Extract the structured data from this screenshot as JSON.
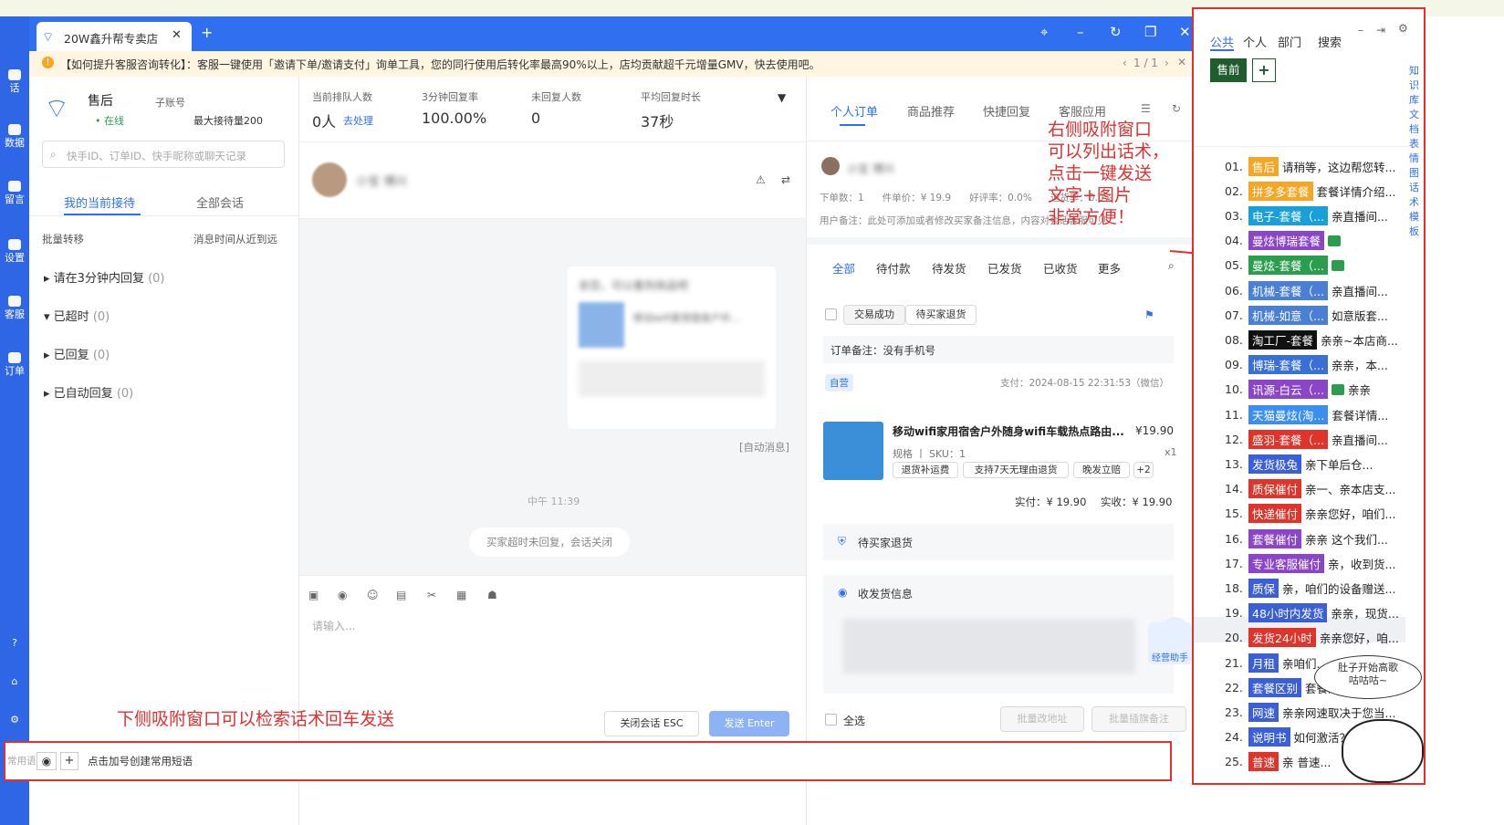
{
  "window": {
    "tab_title": "20W鑫升帮专卖店",
    "new_tab": "+",
    "close_tab": "✕"
  },
  "notice": {
    "text": "【如何提升客服咨询转化】：客服一键使用「邀请下单/邀请支付」询单工具，您的同行使用后转化率最高90%以上，店均贡献超千元增量GMV，快去使用吧。",
    "pager": "1 / 1"
  },
  "left_rail": {
    "items": [
      "话",
      "数据",
      "留言",
      "设置",
      "客服",
      "订单"
    ]
  },
  "agent": {
    "name": "售后",
    "role": "子账号",
    "status": "在线",
    "max_load": "最大接待量200",
    "search_placeholder": "快手ID、订单ID、快手昵称或聊天记录"
  },
  "left_tabs": {
    "mine": "我的当前接待",
    "all": "全部会话"
  },
  "batch": {
    "label": "批量转移",
    "sort": "消息时间从近到远"
  },
  "groups": [
    {
      "label": "请在3分钟内回复",
      "count": "(0)"
    },
    {
      "label": "已超时",
      "count": "(0)"
    },
    {
      "label": "已回复",
      "count": "(0)"
    },
    {
      "label": "已自动回复",
      "count": "(0)"
    }
  ],
  "stats": [
    {
      "label": "当前排队人数",
      "value": "0人",
      "extra": "去处理"
    },
    {
      "label": "3分钟回复率",
      "value": "100.00%"
    },
    {
      "label": "未回复人数",
      "value": "0"
    },
    {
      "label": "平均回复时长",
      "value": "37秒"
    }
  ],
  "chat": {
    "contact": "小宝 博兴",
    "card_title": "亲您，可以看到商品吧",
    "card_goods": "移动wifi家用宿舍户外...",
    "auto_msg": "[自动消息]",
    "time": "中午 11:39",
    "system": "买家超时未回复，会话关闭",
    "input_placeholder": "请输入...",
    "close_btn": "关闭会话 ESC",
    "send_btn": "发送 Enter"
  },
  "order": {
    "tabs": [
      "个人订单",
      "商品推荐",
      "快捷回复",
      "客服应用"
    ],
    "buyer": "小宝 博兴",
    "buyer_stats": "下单数：1      件单价：¥ 19.9      好评率：0.0%      退货率：0.0%",
    "remark": "用户备注：此处可添加或者修改买家备注信息，内容对会话客服可见",
    "subtabs": [
      "全部",
      "待付款",
      "待发货",
      "已发货",
      "已收货",
      "更多"
    ],
    "status1": "交易成功",
    "status2": "待买家退货",
    "order_note": "订单备注：没有手机号",
    "self_tag": "自营",
    "pay_time": "支付：2024-08-15 22:31:53（微信）",
    "goods_title": "移动wifi家用宿舍户外随身wifi车载热点路由...",
    "goods_price": "¥19.90",
    "goods_sku": "规格 丨 SKU：1",
    "goods_qty": "x1",
    "goods_tags": [
      "退货补运费",
      "支持7天无理由退货",
      "晚发立赔",
      "+2"
    ],
    "paid": "实付：¥ 19.90",
    "received": "实收：¥ 19.90",
    "returning": "待买家退货",
    "shipping": "收发货信息",
    "select_all": "全选",
    "btn_addr": "批量改地址",
    "btn_flag": "批量插旗备注",
    "assistant": "经营助手"
  },
  "annotations": {
    "right": "右侧吸附窗口\n可以列出话术，\n点击一键发送\n文字+图片\n非常方便！",
    "bottom": "下侧吸附窗口可以检索话术回车发送",
    "bubble": "肚子开始高歌\n咕咕咕~"
  },
  "right_panel": {
    "tabs": [
      "公共",
      "个人",
      "部门",
      "搜索"
    ],
    "btn_after": "售前",
    "btn_add": "+",
    "side_labels": "知识库 文档 表情图 话术模板",
    "rows": [
      {
        "num": "01.",
        "tag": "售后",
        "color": "#f5a623",
        "text": "请稍等，这边帮您转..."
      },
      {
        "num": "02.",
        "tag": "拼多多套餐",
        "color": "#f5a623",
        "text": "套餐详情介绍..."
      },
      {
        "num": "03.",
        "tag": "电子-套餐（...",
        "color": "#1aa0d8",
        "text": "亲直播间..."
      },
      {
        "num": "04.",
        "tag": "曼炫博瑞套餐",
        "color": "#8a45c8",
        "text": ""
      },
      {
        "num": "05.",
        "tag": "曼炫-套餐（...",
        "color": "#2a9d4f",
        "text": ""
      },
      {
        "num": "06.",
        "tag": "机械-套餐（...",
        "color": "#4a7fd6",
        "text": "亲直播间..."
      },
      {
        "num": "07.",
        "tag": "机械-如意（...",
        "color": "#4a7fd6",
        "text": "如意版套..."
      },
      {
        "num": "08.",
        "tag": "淘工厂-套餐",
        "color": "#111111",
        "text": "亲亲~本店商..."
      },
      {
        "num": "09.",
        "tag": "博瑞-套餐（...",
        "color": "#3a6fd8",
        "text": "亲亲，本..."
      },
      {
        "num": "10.",
        "tag": "讯源-白云（...",
        "color": "#8a45c8",
        "text": "亲亲"
      },
      {
        "num": "11.",
        "tag": "天猫曼炫(淘...",
        "color": "#3a8ef0",
        "text": "套餐详情..."
      },
      {
        "num": "12.",
        "tag": "盛羽-套餐（...",
        "color": "#e0342a",
        "text": "亲直播间..."
      },
      {
        "num": "13.",
        "tag": "发货极兔",
        "color": "#3a5fd8",
        "text": "亲下单后仓..."
      },
      {
        "num": "14.",
        "tag": "质保催付",
        "color": "#e0342a",
        "text": "亲一、亲本店支..."
      },
      {
        "num": "15.",
        "tag": "快递催付",
        "color": "#e0342a",
        "text": "亲亲您好，咱们..."
      },
      {
        "num": "16.",
        "tag": "套餐催付",
        "color": "#8a45c8",
        "text": "亲亲 这个我们..."
      },
      {
        "num": "17.",
        "tag": "专业客服催付",
        "color": "#8a45c8",
        "text": "亲，收到货..."
      },
      {
        "num": "18.",
        "tag": "质保",
        "color": "#3a5fd8",
        "text": "亲，咱们的设备赠送..."
      },
      {
        "num": "19.",
        "tag": "48小时内发货",
        "color": "#3a5fd8",
        "text": "亲亲，现货..."
      },
      {
        "num": "20.",
        "tag": "发货24小时",
        "color": "#e0342a",
        "text": "亲亲您好，咱..."
      },
      {
        "num": "21.",
        "tag": "月租",
        "color": "#3a5fd8",
        "text": "亲咱们..."
      },
      {
        "num": "22.",
        "tag": "套餐区别",
        "color": "#3a5fd8",
        "text": "套餐的区别..."
      },
      {
        "num": "23.",
        "tag": "网速",
        "color": "#3a5fd8",
        "text": "亲亲网速取决于您当..."
      },
      {
        "num": "24.",
        "tag": "说明书",
        "color": "#3a5fd8",
        "text": "如何激活？..."
      },
      {
        "num": "25.",
        "tag": "普速",
        "color": "#e0342a",
        "text": "亲 普速..."
      }
    ]
  },
  "bottom_bar": {
    "label": "常用语",
    "create": "点击加号创建常用短语"
  }
}
